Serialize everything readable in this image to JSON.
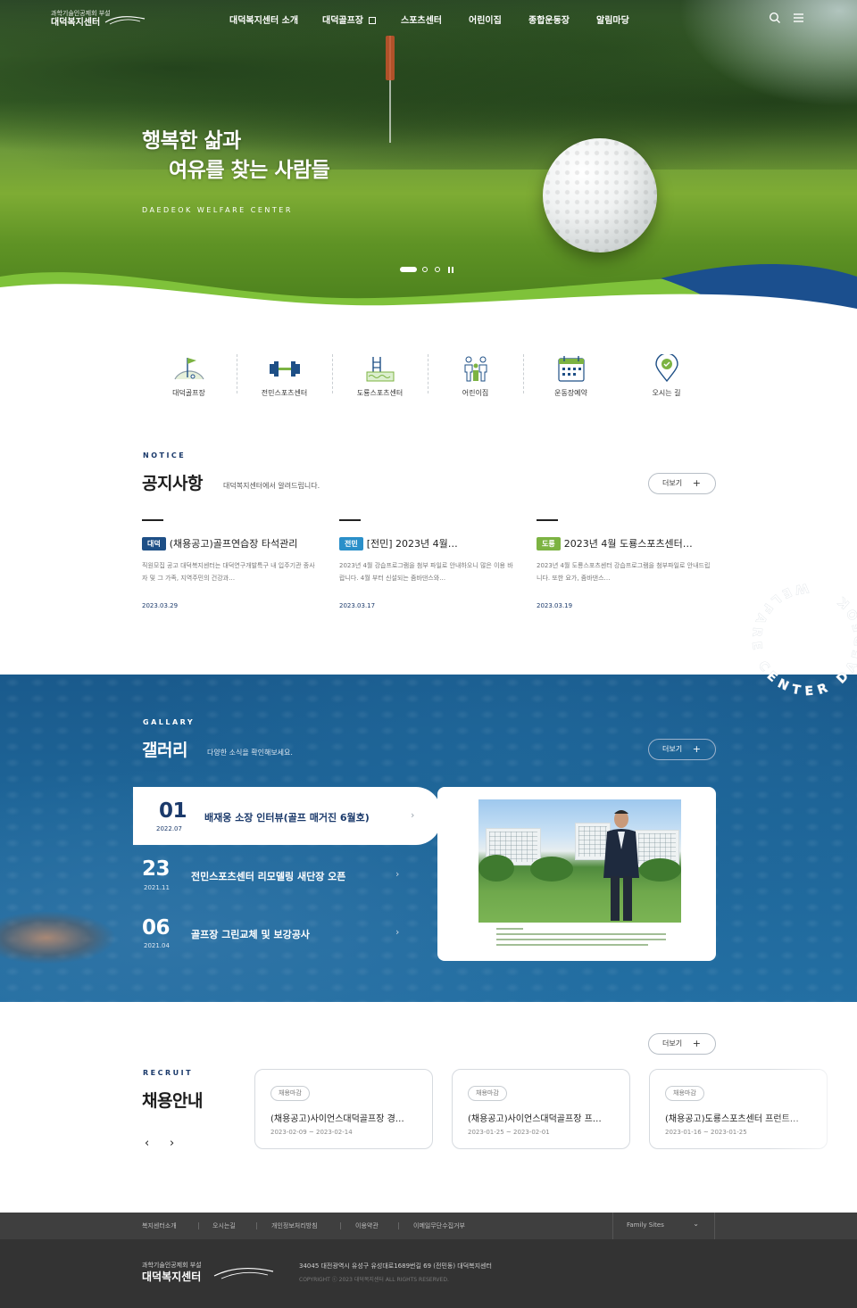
{
  "header": {
    "logo_sub": "과학기술인공제회 부설",
    "logo_main": "대덕복지센터",
    "nav": [
      "대덕복지센터 소개",
      "대덕골프장",
      "스포츠센터",
      "어린이집",
      "종합운동장",
      "알림마당"
    ],
    "external_icon": "external-link-icon",
    "search_icon": "search-icon",
    "menu_icon": "menu-icon"
  },
  "hero": {
    "title_line1": "행복한 삶과",
    "title_line2": "여유를 찾는 사람들",
    "subtitle": "DAEDEOK WELFARE CENTER",
    "slides": 3,
    "active_slide": 1,
    "pause_icon": "pause-icon"
  },
  "quick_menu": [
    {
      "label": "대덕골프장",
      "icon": "golf-flag-icon"
    },
    {
      "label": "전민스포츠센터",
      "icon": "dumbbell-icon"
    },
    {
      "label": "도룡스포츠센터",
      "icon": "swimming-pool-icon"
    },
    {
      "label": "어린이집",
      "icon": "family-icon"
    },
    {
      "label": "운동장예약",
      "icon": "calendar-icon"
    },
    {
      "label": "오시는 길",
      "icon": "location-pin-icon"
    }
  ],
  "notice": {
    "eyebrow": "NOTICE",
    "title": "공지사항",
    "desc": "대덕복지센터에서 알려드립니다.",
    "more": "더보기",
    "items": [
      {
        "badge": "대덕",
        "badge_color": "#1e4f86",
        "title": "(채용공고)골프연습장 타석관리",
        "body": "직원모집 공고  대덕복지센터는 대덕연구개발특구 내 입주기관 종사자 및 그 가족, 지역주민의 건강과…",
        "date": "2023.03.29"
      },
      {
        "badge": "전민",
        "badge_color": "#2a8fc9",
        "title": "[전민] 2023년 4월…",
        "body": "2023년 4월 강습프로그램을 첨부 파일로 안내하오니 많은 이용 바랍니다. 4월 부터 신설되는 줌바댄스와…",
        "date": "2023.03.17"
      },
      {
        "badge": "도룡",
        "badge_color": "#7cb342",
        "title": "2023년 4월 도룡스포츠센터…",
        "body": "2023년  4월 도룡스포츠센터  강습프로그램을 첨부파일로  안내드립니다. 또한  요가, 줌바댄스…",
        "date": "2023.03.19"
      }
    ]
  },
  "ring_text": "WELFARE CENTER DAEDEOK",
  "gallery": {
    "eyebrow": "GALLARY",
    "title": "갤러리",
    "desc": "다양한 소식을 확인해보세요.",
    "more": "더보기",
    "items": [
      {
        "num": "01",
        "date": "2022.07",
        "title": "배재웅 소장 인터뷰(골프 매거진 6월호)"
      },
      {
        "num": "23",
        "date": "2021.11",
        "title": "전민스포츠센터 리모델링 새단장 오픈"
      },
      {
        "num": "06",
        "date": "2021.04",
        "title": "골프장 그린교체 및 보강공사"
      }
    ]
  },
  "recruit": {
    "eyebrow": "RECRUIT",
    "title": "채용안내",
    "more": "더보기",
    "prev_icon": "chevron-left-icon",
    "next_icon": "chevron-right-icon",
    "items": [
      {
        "tag": "채용마감",
        "title": "(채용공고)사이언스대덕골프장 경…",
        "period": "2023-02-09 ~ 2023-02-14"
      },
      {
        "tag": "채용마감",
        "title": "(채용공고)사이언스대덕골프장 프…",
        "period": "2023-01-25 ~ 2023-02-01"
      },
      {
        "tag": "채용마감",
        "title": "(채용공고)도룡스포츠센터 프런트…",
        "period": "2023-01-16 ~ 2023-01-25"
      }
    ]
  },
  "footer": {
    "links": [
      "복지센터소개",
      "오시는길",
      "개인정보처리방침",
      "이용약관",
      "이메일무단수집거부"
    ],
    "family_sites": "Family Sites",
    "logo_sub": "과학기술인공제회 부설",
    "logo_main": "대덕복지센터",
    "address": "34045 대전광역시 유성구 유성대로1689번길 69 (전민동) 대덕복지센터",
    "copyright": "COPYRIGHT ⓒ 2023 대덕복지센터 ALL RIGHTS RESERVED."
  }
}
